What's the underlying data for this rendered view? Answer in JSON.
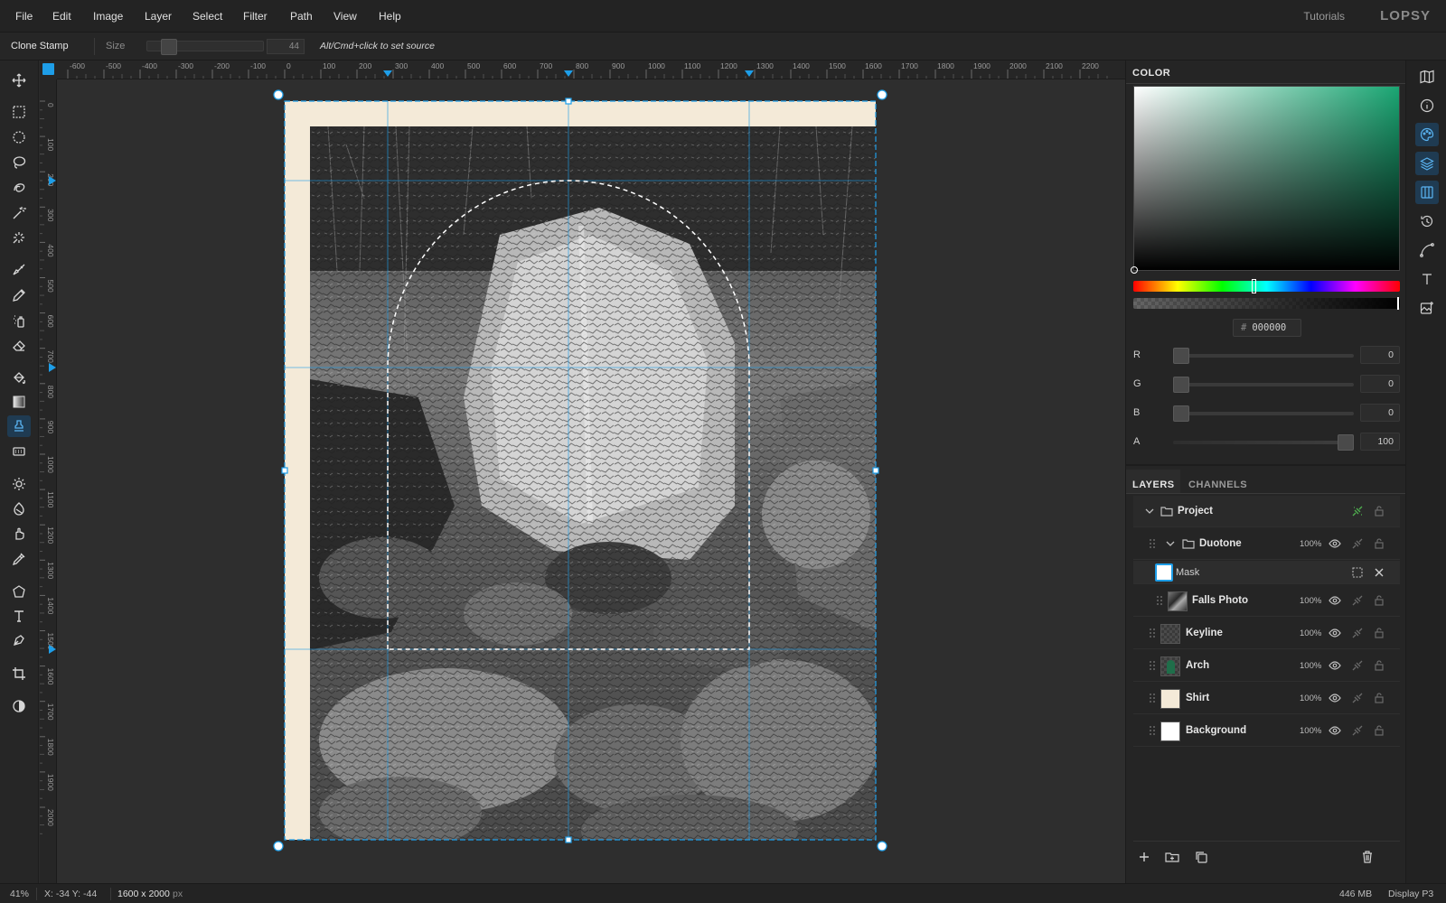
{
  "menu": [
    "File",
    "Edit",
    "Image",
    "Layer",
    "Select",
    "Filter",
    "Path",
    "View",
    "Help"
  ],
  "header": {
    "tutorials": "Tutorials",
    "brand": "LOPSY"
  },
  "options": {
    "tool_name": "Clone Stamp",
    "size_label": "Size",
    "size_value": "44",
    "hint": "Alt/Cmd+click to set source"
  },
  "rulers": {
    "h_labels": [
      "-600",
      "-500",
      "-400",
      "-300",
      "-200",
      "-100",
      "0",
      "100",
      "200",
      "300",
      "400",
      "500",
      "600",
      "700",
      "800",
      "900",
      "1000",
      "1100",
      "1200",
      "1300",
      "1400",
      "1500",
      "1600",
      "1700",
      "1800",
      "1900",
      "2000",
      "2100",
      "2200"
    ],
    "v_labels": [
      "0",
      "100",
      "200",
      "300",
      "400",
      "500",
      "600",
      "700",
      "800",
      "900",
      "1000",
      "1100",
      "1200",
      "1300",
      "1400",
      "1500",
      "1600",
      "1700",
      "1800",
      "1900",
      "2000"
    ]
  },
  "tools": [
    "move-icon",
    "marquee-rect-icon",
    "marquee-ellipse-icon",
    "lasso-icon",
    "quick-select-icon",
    "magic-wand-icon",
    "object-select-icon",
    "brush-icon",
    "pencil-icon",
    "spray-icon",
    "eraser-icon",
    "bucket-icon",
    "gradient-icon",
    "clone-stamp-icon",
    "pattern-stamp-icon",
    "dodge-icon",
    "burn-icon",
    "smudge-icon",
    "eyedropper-icon",
    "shape-icon",
    "text-icon",
    "pen-icon",
    "crop-icon",
    "contrast-icon"
  ],
  "color_panel": {
    "tab": "COLOR",
    "hex": "000000",
    "channels": [
      {
        "label": "R",
        "value": "0",
        "fraction": 0
      },
      {
        "label": "G",
        "value": "0",
        "fraction": 0
      },
      {
        "label": "B",
        "value": "0",
        "fraction": 0
      },
      {
        "label": "A",
        "value": "100",
        "fraction": 1
      }
    ]
  },
  "layers_panel": {
    "tabs": [
      "LAYERS",
      "CHANNELS"
    ],
    "rows": [
      {
        "name": "Project",
        "opacity": "",
        "type": "group-root"
      },
      {
        "name": "Duotone",
        "opacity": "100%",
        "type": "group"
      },
      {
        "name": "Mask",
        "opacity": "",
        "type": "mask"
      },
      {
        "name": "Falls Photo",
        "opacity": "100%",
        "type": "photo"
      },
      {
        "name": "Keyline",
        "opacity": "100%",
        "type": "transparent"
      },
      {
        "name": "Arch",
        "opacity": "100%",
        "type": "arch"
      },
      {
        "name": "Shirt",
        "opacity": "100%",
        "type": "shirt"
      },
      {
        "name": "Background",
        "opacity": "100%",
        "type": "white"
      }
    ]
  },
  "status": {
    "zoom": "41%",
    "coords": "X: -34  Y: -44",
    "doc_size": "1600 x 2000",
    "doc_unit": "px",
    "memory": "446 MB",
    "color_profile": "Display P3"
  },
  "colors": {
    "accent": "#1e9ee8",
    "guide": "#1e9ee8",
    "shirt": "#f4ead8"
  }
}
